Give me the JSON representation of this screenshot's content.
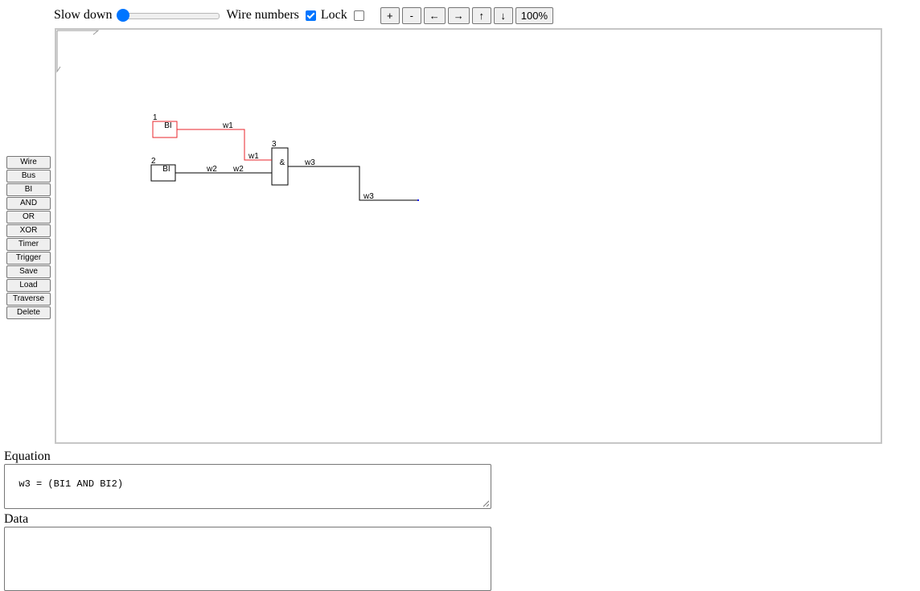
{
  "toolbar": {
    "slow_down_label": "Slow down",
    "slow_down_value": 0,
    "wire_numbers_label": "Wire numbers",
    "wire_numbers_checked": true,
    "lock_label": "Lock",
    "lock_checked": false,
    "buttons": [
      "+",
      "-",
      "←",
      "→",
      "↑",
      "↓",
      "100%"
    ]
  },
  "palette": [
    "Wire",
    "Bus",
    "BI",
    "AND",
    "OR",
    "XOR",
    "Timer",
    "Trigger",
    "Save",
    "Load",
    "Traverse",
    "Delete"
  ],
  "diagram": {
    "blocks": [
      {
        "number": "1",
        "label": "BI",
        "selected": true
      },
      {
        "number": "2",
        "label": "BI",
        "selected": false
      },
      {
        "number": "3",
        "label": "&",
        "selected": false
      }
    ],
    "wires": [
      {
        "name": "w1",
        "color": "#e8262b"
      },
      {
        "name": "w2",
        "color": "#000000"
      },
      {
        "name": "w3",
        "color": "#000000"
      }
    ],
    "selected_color": "#e8262b"
  },
  "equation": {
    "label": "Equation",
    "value": "w3 = (BI1 AND BI2)"
  },
  "data_section": {
    "label": "Data",
    "value": ""
  }
}
